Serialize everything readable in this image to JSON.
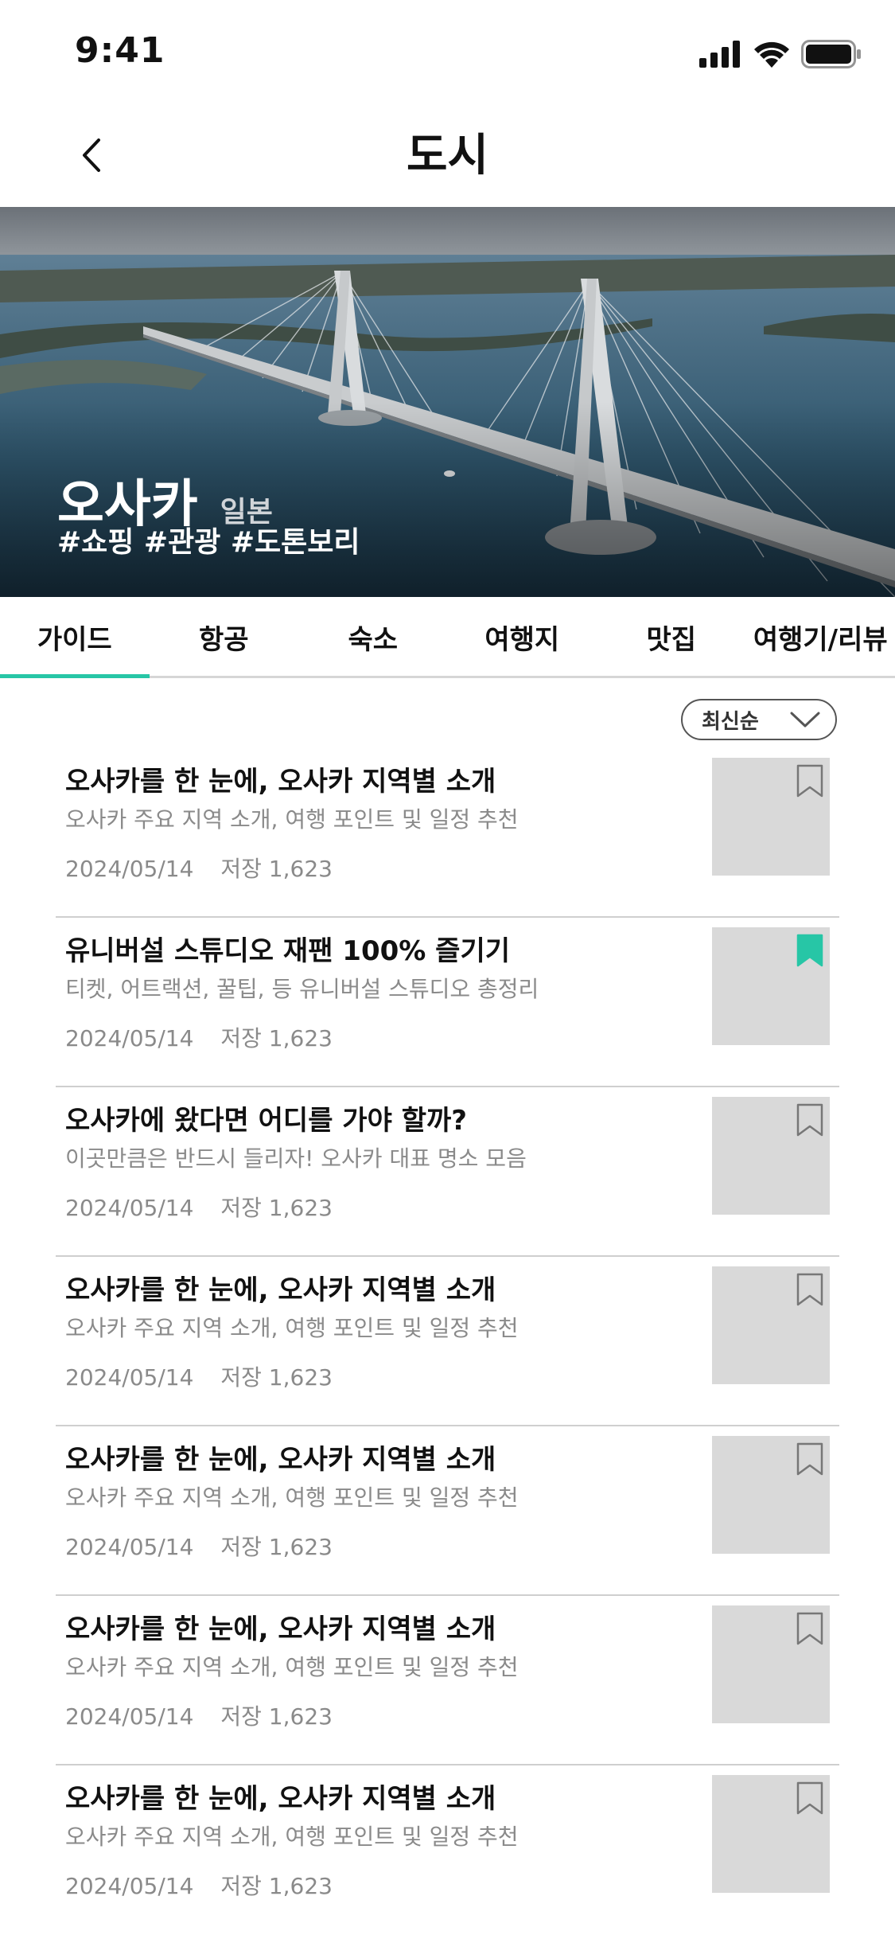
{
  "status_bar": {
    "time": "9:41"
  },
  "header": {
    "title": "도시"
  },
  "hero": {
    "city": "오사카",
    "country": "일본",
    "tags": "#쇼핑 #관광 #도톤보리"
  },
  "tabs": [
    {
      "label": "가이드",
      "active": true
    },
    {
      "label": "항공",
      "active": false
    },
    {
      "label": "숙소",
      "active": false
    },
    {
      "label": "여행지",
      "active": false
    },
    {
      "label": "맛집",
      "active": false
    },
    {
      "label": "여행기/리뷰",
      "active": false
    }
  ],
  "sort": {
    "label": "최신순"
  },
  "articles": [
    {
      "title": "오사카를 한 눈에, 오사카 지역별 소개",
      "subtitle": "오사카 주요 지역 소개, 여행 포인트 및 일정 추천",
      "date": "2024/05/14",
      "saves": "저장 1,623",
      "bookmarked": false
    },
    {
      "title": "유니버설 스튜디오 재팬 100% 즐기기",
      "subtitle": "티켓, 어트랙션, 꿀팁, 등 유니버설 스튜디오 총정리",
      "date": "2024/05/14",
      "saves": "저장 1,623",
      "bookmarked": true
    },
    {
      "title": "오사카에 왔다면 어디를 가야 할까?",
      "subtitle": "이곳만큼은 반드시 들리자! 오사카 대표 명소 모음",
      "date": "2024/05/14",
      "saves": "저장 1,623",
      "bookmarked": false
    },
    {
      "title": "오사카를 한 눈에, 오사카 지역별 소개",
      "subtitle": "오사카 주요 지역 소개, 여행 포인트 및 일정 추천",
      "date": "2024/05/14",
      "saves": "저장 1,623",
      "bookmarked": false
    },
    {
      "title": "오사카를 한 눈에, 오사카 지역별 소개",
      "subtitle": "오사카 주요 지역 소개, 여행 포인트 및 일정 추천",
      "date": "2024/05/14",
      "saves": "저장 1,623",
      "bookmarked": false
    },
    {
      "title": "오사카를 한 눈에, 오사카 지역별 소개",
      "subtitle": "오사카 주요 지역 소개, 여행 포인트 및 일정 추천",
      "date": "2024/05/14",
      "saves": "저장 1,623",
      "bookmarked": false
    },
    {
      "title": "오사카를 한 눈에, 오사카 지역별 소개",
      "subtitle": "오사카 주요 지역 소개, 여행 포인트 및 일정 추천",
      "date": "2024/05/14",
      "saves": "저장 1,623",
      "bookmarked": false
    }
  ],
  "colors": {
    "accent": "#27c6a6",
    "thumb_placeholder": "#d9d9d9",
    "muted_text": "#8a8a8a"
  },
  "icons": [
    "signal-icon",
    "wifi-icon",
    "battery-icon",
    "back-chevron-icon",
    "chevron-down-icon",
    "bookmark-icon"
  ]
}
